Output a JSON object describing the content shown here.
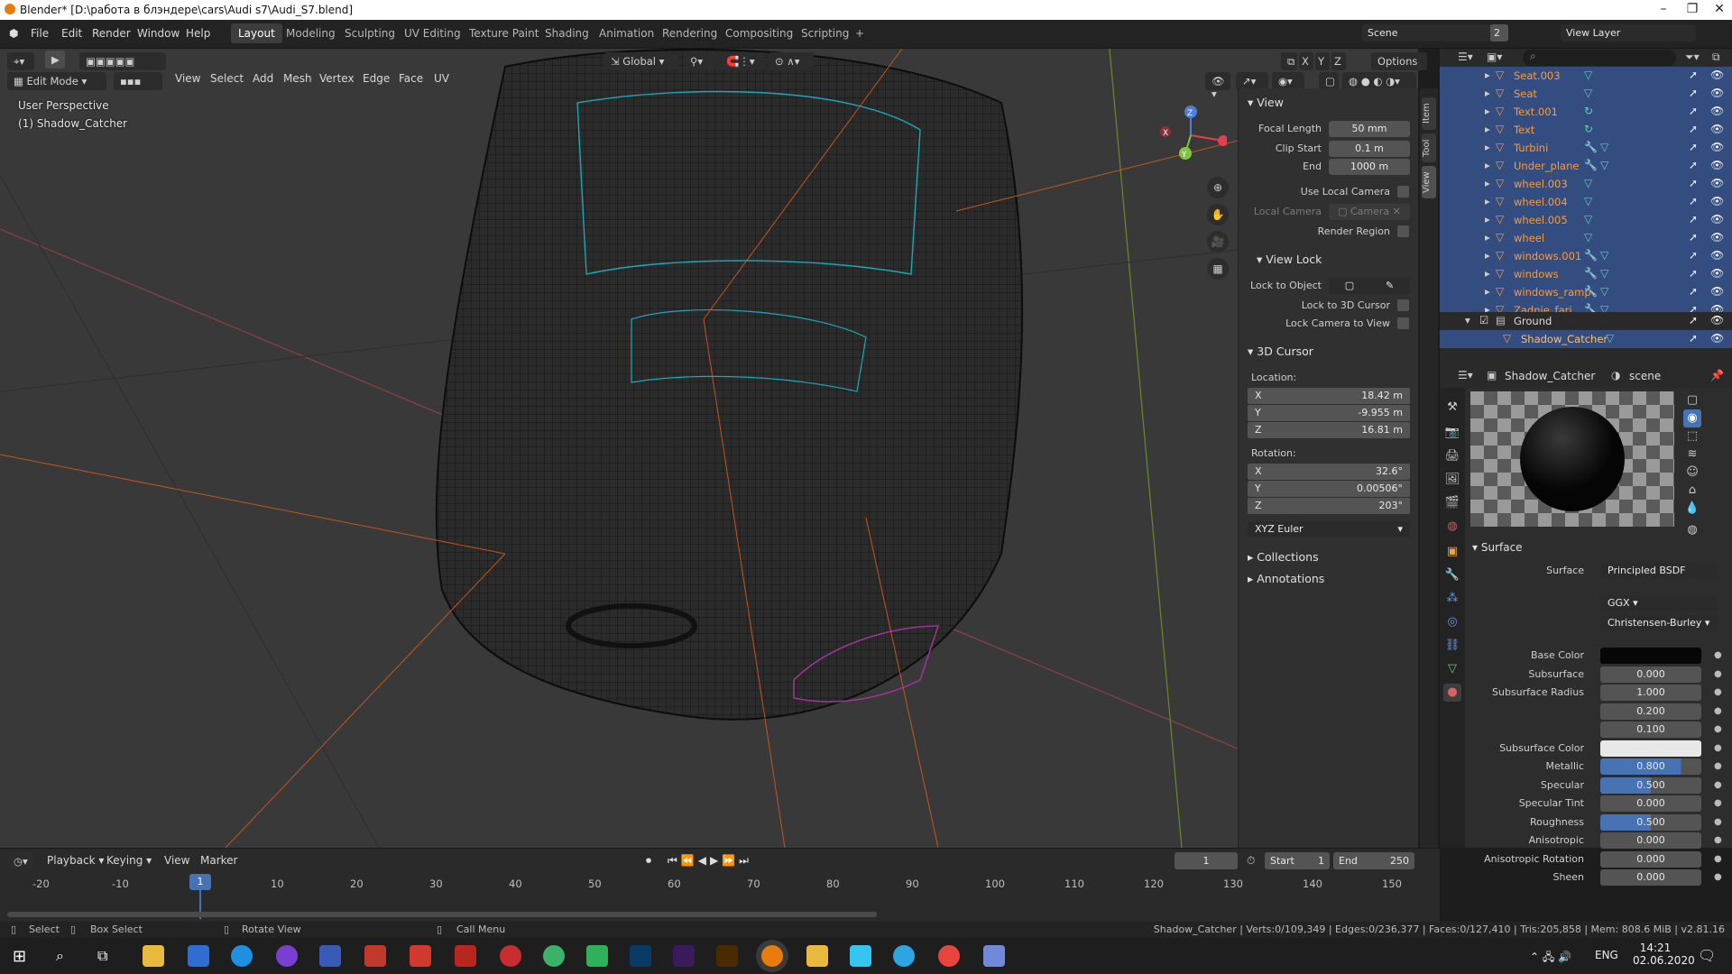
{
  "window": {
    "title": "Blender* [D:\\работа в блэндере\\cars\\Audi s7\\Audi_S7.blend]"
  },
  "menubar": {
    "menus": [
      "File",
      "Edit",
      "Render",
      "Window",
      "Help"
    ],
    "workspaces": [
      "Layout",
      "Modeling",
      "Sculpting",
      "UV Editing",
      "Texture Paint",
      "Shading",
      "Animation",
      "Rendering",
      "Compositing",
      "Scripting",
      "+"
    ],
    "scene": "Scene",
    "scene_count": "2",
    "view_layer": "View Layer"
  },
  "viewport_header": {
    "mode": "Edit Mode",
    "menus": [
      "View",
      "Select",
      "Add",
      "Mesh",
      "Vertex",
      "Edge",
      "Face",
      "UV"
    ],
    "orientation": "Global",
    "options": "Options",
    "axes": [
      "X",
      "Y",
      "Z"
    ]
  },
  "viewport": {
    "perspective": "User Perspective",
    "object": "(1) Shadow_Catcher",
    "gizmo_axes": [
      "X",
      "Y",
      "Z"
    ]
  },
  "npanel": {
    "tabs": [
      "Item",
      "Tool",
      "View"
    ],
    "view": {
      "header": "View",
      "focal_label": "Focal Length",
      "focal": "50 mm",
      "clip_start_label": "Clip Start",
      "clip_start": "0.1 m",
      "clip_end_label": "End",
      "clip_end": "1000 m",
      "use_local_camera": "Use Local Camera",
      "local_camera": "Local Camera",
      "camera": "Camera",
      "render_region": "Render Region"
    },
    "view_lock": {
      "header": "View Lock",
      "lock_to_object": "Lock to Object",
      "lock_to_cursor": "Lock to 3D Cursor",
      "lock_camera": "Lock Camera to View"
    },
    "cursor": {
      "header": "3D Cursor",
      "location": "Location:",
      "loc": [
        {
          "axis": "X",
          "value": "18.42 m"
        },
        {
          "axis": "Y",
          "value": "-9.955 m"
        },
        {
          "axis": "Z",
          "value": "16.81 m"
        }
      ],
      "rotation": "Rotation:",
      "rot": [
        {
          "axis": "X",
          "value": "32.6°"
        },
        {
          "axis": "Y",
          "value": "0.00506°"
        },
        {
          "axis": "Z",
          "value": "203°"
        }
      ],
      "mode": "XYZ Euler"
    },
    "collections": "Collections",
    "annotations": "Annotations"
  },
  "outliner": {
    "rows": [
      {
        "name": "Seat.003",
        "mods": [
          "▽"
        ]
      },
      {
        "name": "Seat",
        "mods": [
          "▽"
        ]
      },
      {
        "name": "Text.001",
        "mods": [
          "↻"
        ]
      },
      {
        "name": "Text",
        "mods": [
          "↻"
        ]
      },
      {
        "name": "Turbini",
        "mods": [
          "🔧",
          "▽"
        ]
      },
      {
        "name": "Under_plane",
        "mods": [
          "🔧",
          "▽"
        ]
      },
      {
        "name": "wheel.003",
        "mods": [
          "▽"
        ]
      },
      {
        "name": "wheel.004",
        "mods": [
          "▽"
        ]
      },
      {
        "name": "wheel.005",
        "mods": [
          "▽"
        ]
      },
      {
        "name": "wheel",
        "mods": [
          "▽"
        ]
      },
      {
        "name": "windows.001",
        "mods": [
          "🔧",
          "▽"
        ]
      },
      {
        "name": "windows",
        "mods": [
          "🔧",
          "▽"
        ]
      },
      {
        "name": "windows_ramp",
        "mods": [
          "🔧",
          "▽"
        ]
      },
      {
        "name": "Zadnie_fari",
        "mods": [
          "🔧",
          "▽"
        ]
      }
    ],
    "ground": "Ground",
    "shadow_catcher": "Shadow_Catcher"
  },
  "properties": {
    "object": "Shadow_Catcher",
    "world": "scene",
    "surface_header": "Surface",
    "surface_label": "Surface",
    "surface": "Principled BSDF",
    "distribution": "GGX",
    "subsurface_method": "Christensen-Burley",
    "rows": [
      {
        "label": "Base Color",
        "value": "",
        "kind": "color-dark"
      },
      {
        "label": "Subsurface",
        "value": "0.000",
        "fill": 0
      },
      {
        "label": "Subsurface Radius",
        "value": "1.000",
        "fill": 0
      },
      {
        "label": "",
        "value": "0.200",
        "fill": 0
      },
      {
        "label": "",
        "value": "0.100",
        "fill": 0
      },
      {
        "label": "Subsurface Color",
        "value": "",
        "kind": "color-white"
      },
      {
        "label": "Metallic",
        "value": "0.800",
        "fill": 0.8
      },
      {
        "label": "Specular",
        "value": "0.500",
        "fill": 0.5
      },
      {
        "label": "Specular Tint",
        "value": "0.000",
        "fill": 0
      },
      {
        "label": "Roughness",
        "value": "0.500",
        "fill": 0.5
      },
      {
        "label": "Anisotropic",
        "value": "0.000",
        "fill": 0
      },
      {
        "label": "Anisotropic Rotation",
        "value": "0.000",
        "fill": 0
      },
      {
        "label": "Sheen",
        "value": "0.000",
        "fill": 0
      }
    ]
  },
  "timeline": {
    "menus": [
      "Playback",
      "Keying",
      "View",
      "Marker"
    ],
    "current_frame": "1",
    "start_label": "Start",
    "start": "1",
    "end_label": "End",
    "end": "250",
    "ticks": [
      "-20",
      "-10",
      "1",
      "10",
      "20",
      "30",
      "40",
      "50",
      "60",
      "70",
      "80",
      "90",
      "100",
      "110",
      "120",
      "130",
      "140",
      "150"
    ],
    "playhead": "1"
  },
  "statusbar": {
    "select": "Select",
    "box_select": "Box Select",
    "rotate": "Rotate View",
    "call_menu": "Call Menu",
    "stats": "Shadow_Catcher | Verts:0/109,349 | Edges:0/236,377 | Faces:0/127,410 | Tris:205,858 | Mem: 808.6 MiB | v2.81.16"
  },
  "taskbar": {
    "lang": "ENG",
    "time": "14:21",
    "date": "02.06.2020"
  },
  "colors": {
    "accent_blue": "#4772b3",
    "selected_orange": "#ff9a33",
    "outliner_select": "#334d80"
  }
}
